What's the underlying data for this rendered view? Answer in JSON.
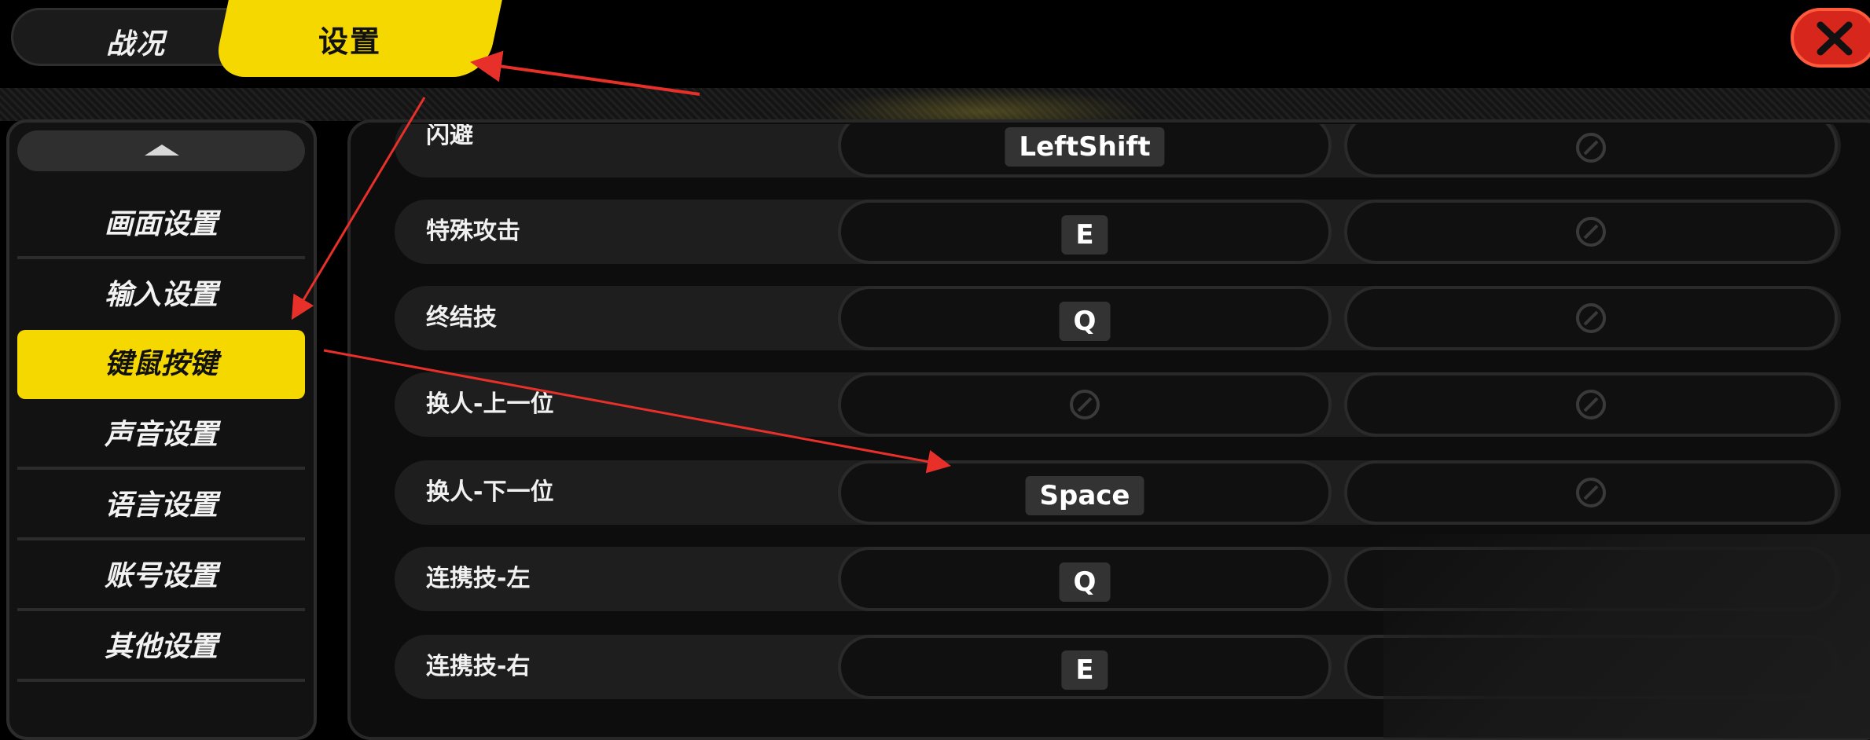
{
  "tabs": [
    {
      "label": "战况",
      "active": false
    },
    {
      "label": "设置",
      "active": true
    }
  ],
  "close_icon": "close-icon",
  "sidebar": {
    "scroll_up_icon": "triangle-up-icon",
    "items": [
      {
        "label": "画面设置",
        "active": false
      },
      {
        "label": "输入设置",
        "active": false
      },
      {
        "label": "键鼠按键",
        "active": true
      },
      {
        "label": "声音设置",
        "active": false
      },
      {
        "label": "语言设置",
        "active": false
      },
      {
        "label": "账号设置",
        "active": false
      },
      {
        "label": "其他设置",
        "active": false
      }
    ]
  },
  "bindings": [
    {
      "action": "闪避",
      "primary": "LeftShift",
      "secondary": ""
    },
    {
      "action": "特殊攻击",
      "primary": "E",
      "secondary": ""
    },
    {
      "action": "终结技",
      "primary": "Q",
      "secondary": ""
    },
    {
      "action": "换人-上一位",
      "primary": "",
      "secondary": ""
    },
    {
      "action": "换人-下一位",
      "primary": "Space",
      "secondary": ""
    },
    {
      "action": "连携技-左",
      "primary": "Q",
      "secondary": ""
    },
    {
      "action": "连携技-右",
      "primary": "E",
      "secondary": ""
    }
  ],
  "colors": {
    "accent": "#f5d800",
    "close": "#d7261c",
    "annotation_arrow": "#e8302a"
  }
}
